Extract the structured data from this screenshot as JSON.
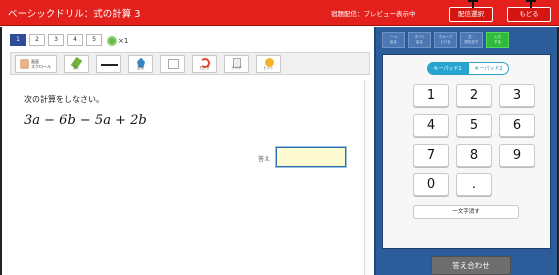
{
  "header": {
    "title": "ベーシックドリル：式の計算 3",
    "delivery_status": "宿題配信：プレビュー表示中",
    "select_button": "配信選択",
    "back_button": "もどる"
  },
  "page_tabs": [
    "1",
    "2",
    "3",
    "4",
    "5"
  ],
  "correct_count": "×1",
  "toolbar": {
    "scroll": "画面\nスクロール",
    "pen": "書く",
    "line": "",
    "marker": "塗る",
    "eraser": "",
    "undo": "もどす",
    "clear": "クリア",
    "hint": "ヒント"
  },
  "problem": {
    "instruction": "次の計算をしなさい。",
    "expression": "3a − 6b − 5a + 2b",
    "answer_label": "答え"
  },
  "panel_tabs": [
    "一つ\n戻る",
    "すべて\n戻る",
    "グループ\nとける",
    "式・\n図を記す",
    "入力\nする"
  ],
  "keypad": {
    "mode1": "キーパッド1",
    "mode2": "キーパッド2",
    "keys": [
      "1",
      "2",
      "3",
      "4",
      "5",
      "6",
      "7",
      "8",
      "9",
      "0",
      "."
    ],
    "delete": "一文字消す",
    "check_button": "答え合わせ"
  },
  "colors": {
    "header_red": "#e3201b",
    "panel_blue": "#2c5c99",
    "active_green": "#2fba3b",
    "answer_bg": "#fffbd0"
  }
}
